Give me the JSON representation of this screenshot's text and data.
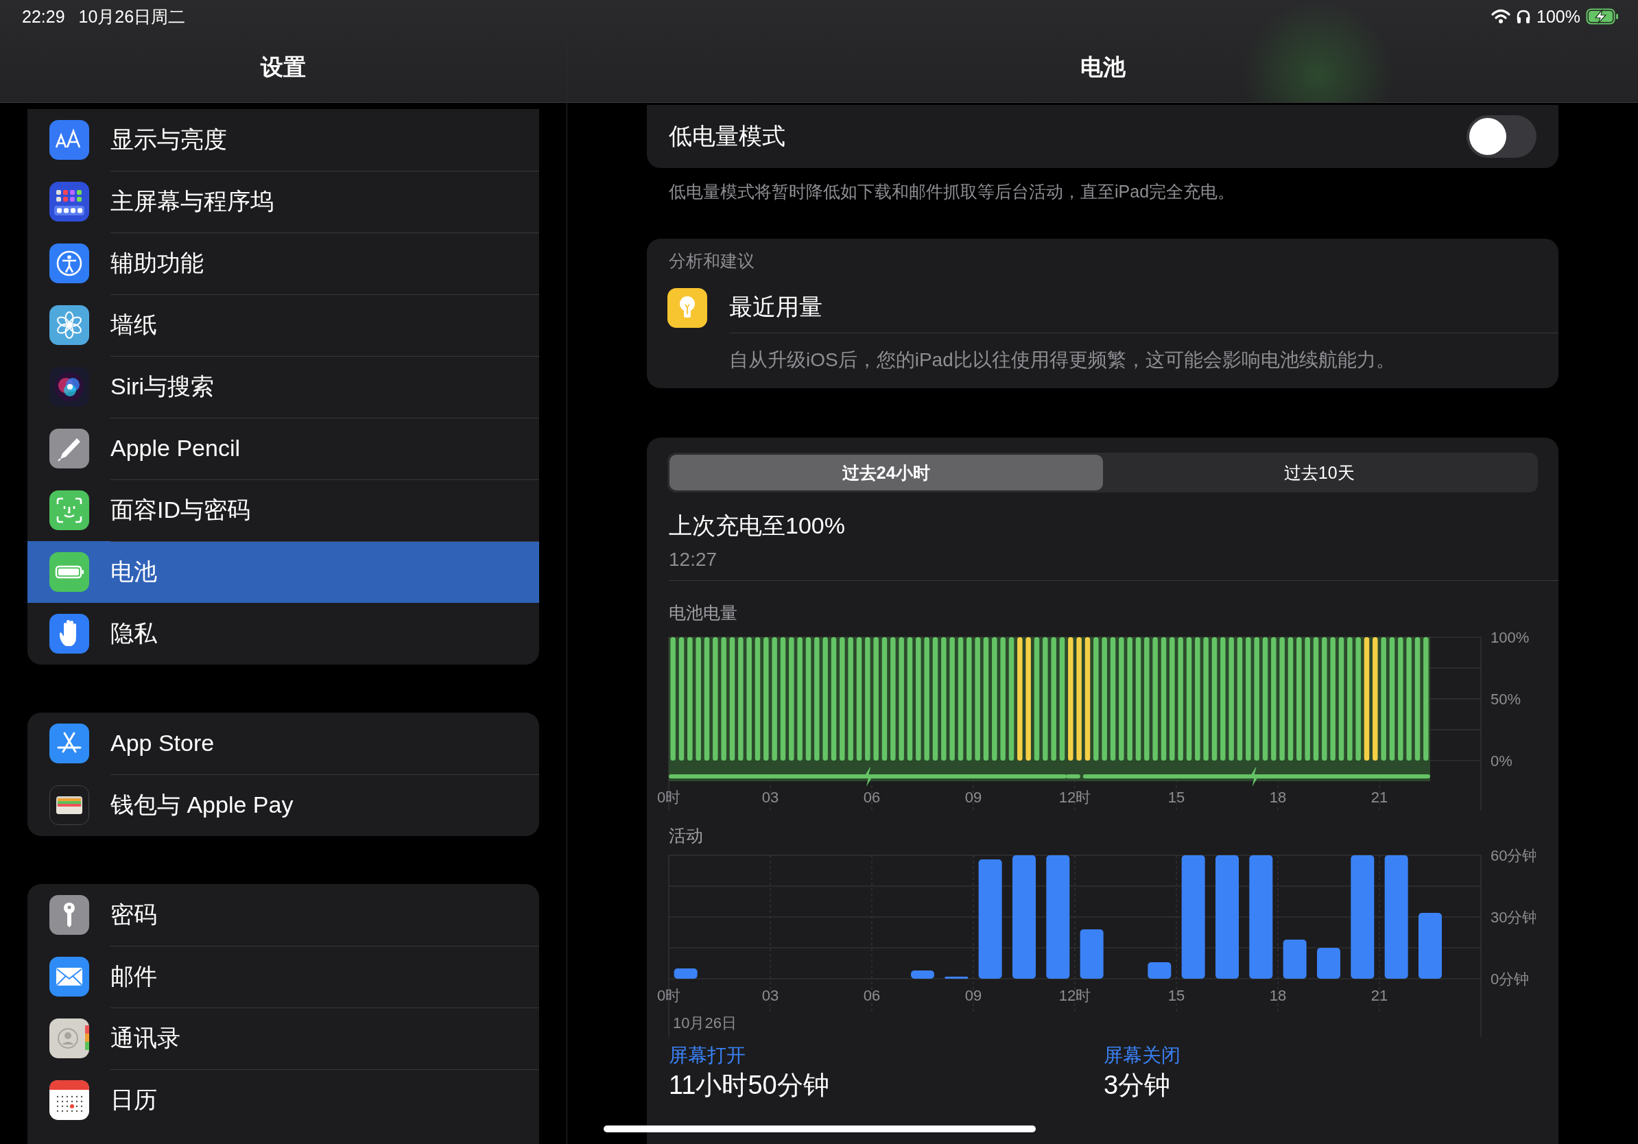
{
  "status_bar": {
    "time": "22:29",
    "date": "10月26日周二",
    "battery_text": "100%",
    "charging": true
  },
  "sidebar": {
    "title": "设置",
    "groups": [
      {
        "items": [
          {
            "label": "显示与亮度",
            "kind": "display",
            "selected": false
          },
          {
            "label": "主屏幕与程序坞",
            "kind": "homescreen",
            "selected": false
          },
          {
            "label": "辅助功能",
            "kind": "accessibility",
            "selected": false
          },
          {
            "label": "墙纸",
            "kind": "wallpaper",
            "selected": false
          },
          {
            "label": "Siri与搜索",
            "kind": "siri",
            "selected": false
          },
          {
            "label": "Apple Pencil",
            "kind": "pencil",
            "selected": false
          },
          {
            "label": "面容ID与密码",
            "kind": "faceid",
            "selected": false
          },
          {
            "label": "电池",
            "kind": "battery",
            "selected": true
          },
          {
            "label": "隐私",
            "kind": "privacy",
            "selected": false
          }
        ]
      },
      {
        "items": [
          {
            "label": "App Store",
            "kind": "appstore",
            "selected": false
          },
          {
            "label": "钱包与 Apple Pay",
            "kind": "wallet",
            "selected": false
          }
        ]
      },
      {
        "items": [
          {
            "label": "密码",
            "kind": "passwords",
            "selected": false
          },
          {
            "label": "邮件",
            "kind": "mail",
            "selected": false
          },
          {
            "label": "通讯录",
            "kind": "contacts",
            "selected": false
          },
          {
            "label": "日历",
            "kind": "calendar",
            "selected": false
          }
        ]
      }
    ]
  },
  "detail": {
    "title": "电池",
    "low_power": {
      "label": "低电量模式",
      "on": false,
      "footnote": "低电量模式将暂时降低如下载和邮件抓取等后台活动，直至iPad完全充电。"
    },
    "insights": {
      "header": "分析和建议",
      "title": "最近用量",
      "description": "自从升级iOS后，您的iPad比以往使用得更频繁，这可能会影响电池续航能力。"
    },
    "usage": {
      "tabs": [
        {
          "label": "过去24小时",
          "selected": true
        },
        {
          "label": "过去10天",
          "selected": false
        }
      ],
      "last_charge": {
        "label": "上次充电至100%",
        "time": "12:27"
      },
      "battery_chart": {
        "chart_data": {
          "type": "bar",
          "title": "电池电量",
          "stacked": true,
          "x": [
            0.125,
            0.375,
            0.625,
            0.875,
            1.125,
            1.375,
            1.625,
            1.875,
            2.125,
            2.375,
            2.625,
            2.875,
            3.125,
            3.375,
            3.625,
            3.875,
            4.125,
            4.375,
            4.625,
            4.875,
            5.125,
            5.375,
            5.625,
            5.875,
            6.125,
            6.375,
            6.625,
            6.875,
            7.125,
            7.375,
            7.625,
            7.875,
            8.125,
            8.375,
            8.625,
            8.875,
            9.125,
            9.375,
            9.625,
            9.875,
            10.125,
            10.375,
            10.625,
            10.875,
            11.125,
            11.375,
            11.625,
            11.875,
            12.125,
            12.375,
            12.625,
            12.875,
            13.125,
            13.375,
            13.625,
            13.875,
            14.125,
            14.375,
            14.625,
            14.875,
            15.125,
            15.375,
            15.625,
            15.875,
            16.125,
            16.375,
            16.625,
            16.875,
            17.125,
            17.375,
            17.625,
            17.875,
            18.125,
            18.375,
            18.625,
            18.875,
            19.125,
            19.375,
            19.625,
            19.875,
            20.125,
            20.375,
            20.625,
            20.875,
            21.125,
            21.375,
            21.625,
            21.875,
            22.125,
            22.375
          ],
          "series": [
            {
              "color": "#65c466",
              "values": [
                100,
                100,
                100,
                100,
                100,
                100,
                100,
                100,
                100,
                100,
                100,
                100,
                100,
                100,
                100,
                100,
                100,
                100,
                100,
                100,
                100,
                100,
                100,
                100,
                100,
                100,
                100,
                100,
                100,
                100,
                100,
                100,
                100,
                100,
                100,
                100,
                100,
                100,
                100,
                100,
                100,
                null,
                null,
                100,
                100,
                100,
                100,
                null,
                null,
                null,
                100,
                100,
                100,
                100,
                100,
                100,
                100,
                100,
                100,
                100,
                100,
                100,
                100,
                100,
                100,
                100,
                100,
                100,
                100,
                100,
                100,
                100,
                100,
                100,
                100,
                100,
                100,
                100,
                100,
                100,
                100,
                100,
                null,
                null,
                100,
                100,
                100,
                100,
                100,
                100
              ]
            },
            {
              "color": "#f5cf46",
              "values": [
                null,
                null,
                null,
                null,
                null,
                null,
                null,
                null,
                null,
                null,
                null,
                null,
                null,
                null,
                null,
                null,
                null,
                null,
                null,
                null,
                null,
                null,
                null,
                null,
                null,
                null,
                null,
                null,
                null,
                null,
                null,
                null,
                null,
                null,
                null,
                null,
                null,
                null,
                null,
                null,
                null,
                100,
                100,
                null,
                null,
                null,
                null,
                100,
                100,
                100,
                null,
                null,
                null,
                null,
                null,
                null,
                null,
                null,
                null,
                null,
                null,
                null,
                null,
                null,
                null,
                null,
                null,
                null,
                null,
                null,
                null,
                null,
                null,
                null,
                null,
                null,
                null,
                null,
                null,
                null,
                null,
                null,
                100,
                100,
                null,
                null,
                null,
                null,
                null,
                null
              ]
            }
          ],
          "xlim": [
            0,
            24
          ],
          "ylim": [
            0,
            100
          ],
          "grid": true,
          "xticks": [
            {
              "value": 0,
              "label": "0时"
            },
            {
              "value": 3,
              "label": "03"
            },
            {
              "value": 6,
              "label": "06"
            },
            {
              "value": 9,
              "label": "09"
            },
            {
              "value": 12,
              "label": "12时"
            },
            {
              "value": 15,
              "label": "15"
            },
            {
              "value": 18,
              "label": "18"
            },
            {
              "value": 21,
              "label": "21"
            }
          ],
          "yticks": [
            {
              "value": 0,
              "label": "0%"
            },
            {
              "value": 50,
              "label": "50%"
            },
            {
              "value": 100,
              "label": "100%"
            }
          ]
        }
      },
      "activity_chart": {
        "date_label": "10月26日",
        "chart_data": {
          "type": "bar",
          "title": "活动",
          "x": [
            0.5,
            7.5,
            8.5,
            9.5,
            10.5,
            11.5,
            12.5,
            14.5,
            15.5,
            16.5,
            17.5,
            18.5,
            19.5,
            20.5,
            21.5,
            22.5
          ],
          "values": [
            5,
            4,
            1,
            58,
            60,
            60,
            24,
            8,
            60,
            60,
            60,
            19,
            15,
            60,
            60,
            32
          ],
          "color": "#3b82f6",
          "xlim": [
            0,
            24
          ],
          "ylim": [
            0,
            60
          ],
          "grid": true,
          "xticks": [
            {
              "value": 0,
              "label": "0时"
            },
            {
              "value": 3,
              "label": "03"
            },
            {
              "value": 6,
              "label": "06"
            },
            {
              "value": 9,
              "label": "09"
            },
            {
              "value": 12,
              "label": "12时"
            },
            {
              "value": 15,
              "label": "15"
            },
            {
              "value": 18,
              "label": "18"
            },
            {
              "value": 21,
              "label": "21"
            }
          ],
          "yticks": [
            {
              "value": 0,
              "label": "0分钟"
            },
            {
              "value": 30,
              "label": "30分钟"
            },
            {
              "value": 60,
              "label": "60分钟"
            }
          ]
        }
      },
      "screen_on": {
        "label": "屏幕打开",
        "value": "11小时50分钟"
      },
      "screen_off": {
        "label": "屏幕关闭",
        "value": "3分钟"
      }
    }
  }
}
